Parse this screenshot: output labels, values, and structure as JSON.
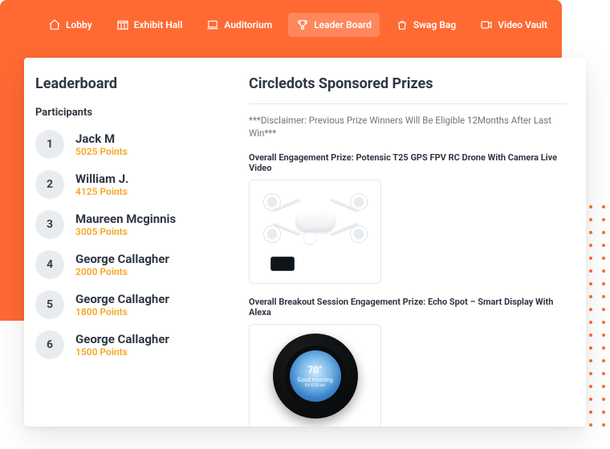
{
  "nav": {
    "items": [
      {
        "label": "Lobby",
        "icon": "home-icon",
        "active": false
      },
      {
        "label": "Exhibit Hall",
        "icon": "booth-icon",
        "active": false
      },
      {
        "label": "Auditorium",
        "icon": "laptop-icon",
        "active": false
      },
      {
        "label": "Leader Board",
        "icon": "trophy-icon",
        "active": true
      },
      {
        "label": "Swag Bag",
        "icon": "bag-icon",
        "active": false
      },
      {
        "label": "Video Vault",
        "icon": "video-icon",
        "active": false
      }
    ]
  },
  "leaderboard": {
    "title": "Leaderboard",
    "subtitle": "Participants",
    "rows": [
      {
        "rank": "1",
        "name": "Jack M",
        "points": "5025 Points"
      },
      {
        "rank": "2",
        "name": "William J.",
        "points": "4125 Points"
      },
      {
        "rank": "3",
        "name": "Maureen Mcginnis",
        "points": "3005 Points"
      },
      {
        "rank": "4",
        "name": "George Callagher",
        "points": "2000 Points"
      },
      {
        "rank": "5",
        "name": "George Callagher",
        "points": "1800 Points"
      },
      {
        "rank": "6",
        "name": "George Callagher",
        "points": "1500 Points"
      }
    ]
  },
  "prizes": {
    "title": "Circledots Sponsored Prizes",
    "disclaimer": "***Disclaimer: Previous Prize Winners Will Be Eligible 12Months After Last Win***",
    "items": [
      {
        "label": "Overall Engagement Prize: Potensic T25 GPS FPV RC Drone With Camera Live Video"
      },
      {
        "label": "Overall Breakout Session Engagement Prize: Echo Spot – Smart Display With Alexa"
      }
    ],
    "spot_display": {
      "temp": "70°",
      "greeting": "Good morning",
      "time": "It's 6:30 am"
    }
  },
  "colors": {
    "accent": "#ff6a33",
    "points": "#f5a623"
  }
}
